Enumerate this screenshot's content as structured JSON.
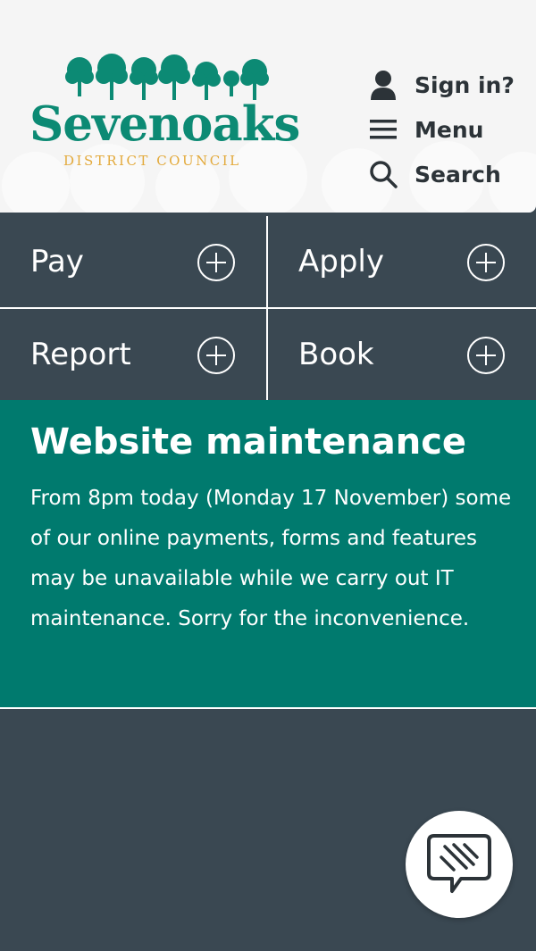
{
  "header": {
    "logo_word": "Sevenoaks",
    "logo_subline": "DISTRICT COUNCIL",
    "links": [
      {
        "label": "Sign in?",
        "icon": "user-icon"
      },
      {
        "label": "Menu",
        "icon": "menu-icon"
      },
      {
        "label": "Search",
        "icon": "search-icon"
      }
    ]
  },
  "tiles": [
    {
      "label": "Pay",
      "icon": "plus-circle-icon"
    },
    {
      "label": "Apply",
      "icon": "plus-circle-icon"
    },
    {
      "label": "Report",
      "icon": "plus-circle-icon"
    },
    {
      "label": "Book",
      "icon": "plus-circle-icon"
    }
  ],
  "banner": {
    "title": "Website maintenance",
    "body": "From 8pm today (Monday 17 November) some of our online payments, forms and features may be unavailable while we carry out IT maintenance. Sorry for the inconvenience."
  },
  "chat": {
    "icon": "chat-icon"
  },
  "colors": {
    "brand_green": "#0c8a74",
    "brand_gold": "#e3aa3c",
    "tile_bg": "#3a4852",
    "banner_bg": "#007a6e",
    "header_bg": "#f5f5f5"
  }
}
